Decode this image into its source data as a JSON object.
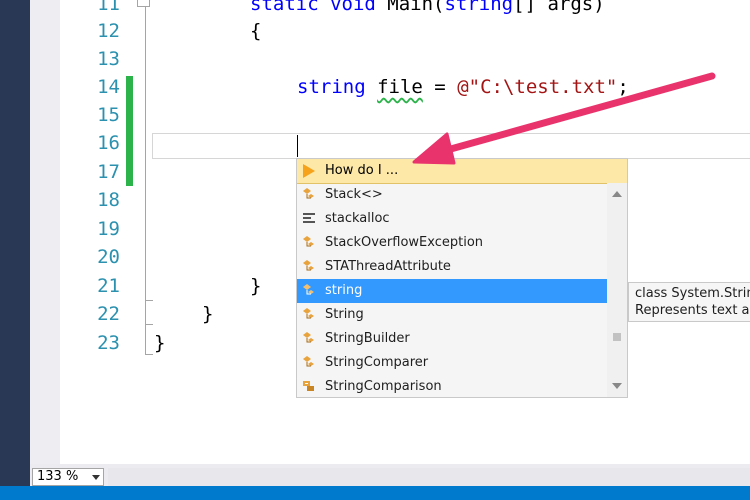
{
  "editor": {
    "line_numbers": [
      "11",
      "12",
      "13",
      "14",
      "15",
      "16",
      "17",
      "18",
      "19",
      "20",
      "21",
      "22",
      "23"
    ],
    "code": {
      "line11_kw": "static void",
      "line11_rest": " Main(",
      "line11_kw2": "string",
      "line11_end": "[] args)",
      "line12": "{",
      "line14_kw": "string",
      "line14_var": "file",
      "line14_eq": " = ",
      "line14_str": "@\"C:\\test.txt\"",
      "line14_end": ";",
      "line21": "}",
      "line22": "}",
      "line23": "}"
    }
  },
  "intellisense": {
    "header": "How do I ...",
    "items": [
      {
        "label": "Stack<>",
        "icon": "class-icon"
      },
      {
        "label": "stackalloc",
        "icon": "keyword-icon"
      },
      {
        "label": "StackOverflowException",
        "icon": "class-icon"
      },
      {
        "label": "STAThreadAttribute",
        "icon": "class-icon"
      },
      {
        "label": "string",
        "icon": "class-icon",
        "selected": true
      },
      {
        "label": "String",
        "icon": "class-icon"
      },
      {
        "label": "StringBuilder",
        "icon": "class-icon"
      },
      {
        "label": "StringComparer",
        "icon": "class-icon"
      },
      {
        "label": "StringComparison",
        "icon": "enum-icon"
      }
    ]
  },
  "tooltip": {
    "line1": "class System.String",
    "line2": "Represents text as"
  },
  "zoom": {
    "value": "133 %"
  },
  "colors": {
    "keyword": "#0000ff",
    "string": "#a31515",
    "line_number": "#2b91af",
    "selection": "#3399ff",
    "arrow": "#e8336d"
  }
}
